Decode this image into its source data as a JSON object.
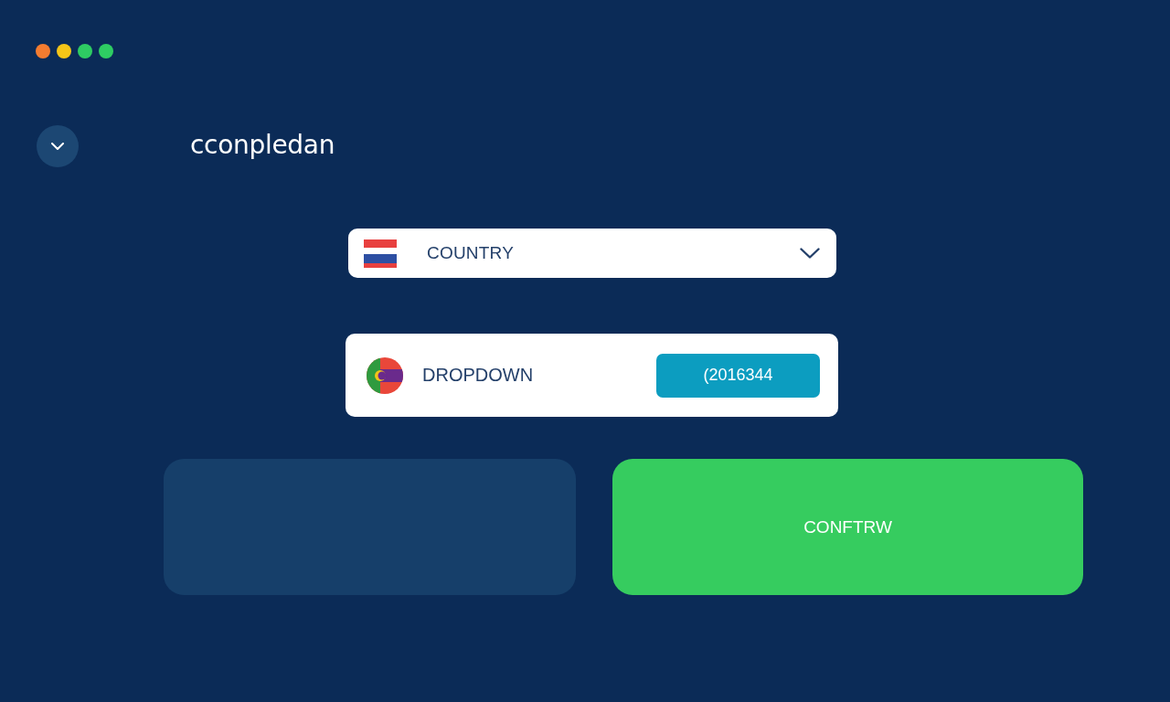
{
  "window": {
    "controls": [
      {
        "color": "#f47c30"
      },
      {
        "color": "#f5c518"
      },
      {
        "color": "#2ecc63"
      },
      {
        "color": "#2ecc63"
      }
    ]
  },
  "header": {
    "title": "cconpledan"
  },
  "country_select": {
    "value": "COUNTRY"
  },
  "dropdown": {
    "label": "DROPDOWN",
    "button": "(2016344"
  },
  "actions": {
    "primary_button": "CONFTRW"
  }
}
